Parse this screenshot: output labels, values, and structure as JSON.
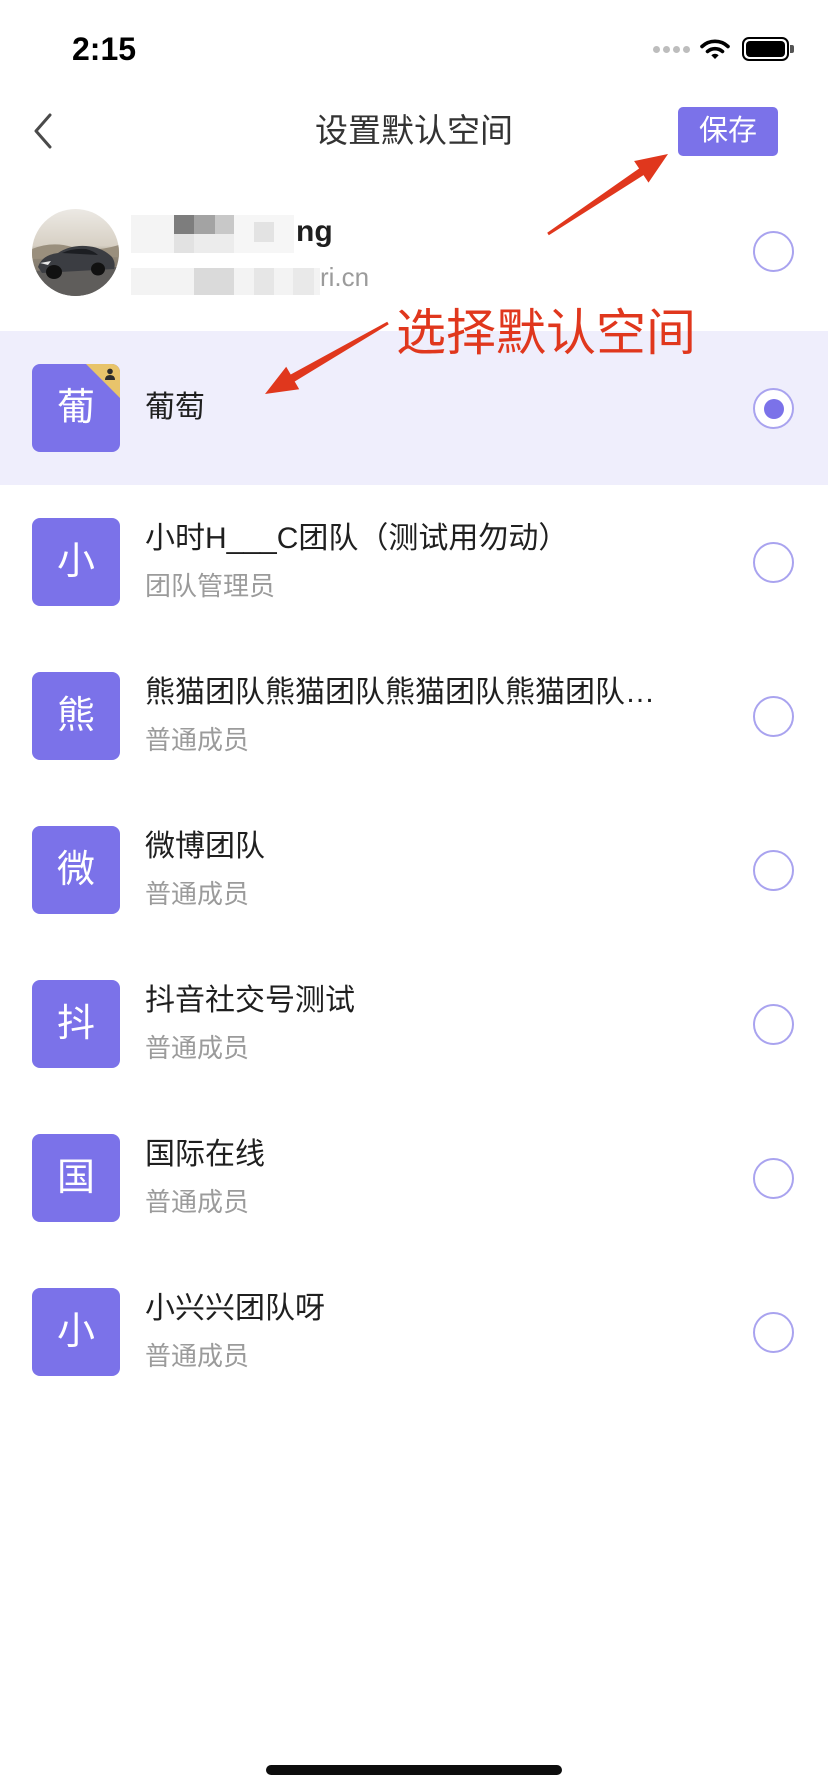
{
  "status_bar": {
    "time": "2:15",
    "icons": [
      "signal-dots-icon",
      "wifi-icon",
      "battery-icon"
    ]
  },
  "nav": {
    "back_icon": "chevron-left-icon",
    "title": "设置默认空间",
    "save_label": "保存"
  },
  "annotation": {
    "text": "选择默认空间"
  },
  "colors": {
    "accent": "#7B72E9",
    "selected_bg": "#EFEEFC",
    "radio_border": "#A9A3EF",
    "annotation": "#E0371D",
    "badge": "#E8C46B"
  },
  "account": {
    "avatar": "car-photo-avatar",
    "name_visible": "ng",
    "email_visible": "ri.cn",
    "selected": false
  },
  "spaces": [
    {
      "icon_char": "葡",
      "name": "葡萄",
      "owner_badge": true,
      "selected": true
    },
    {
      "icon_char": "小",
      "name": "小时H___C团队（测试用勿动）",
      "role": "团队管理员",
      "selected": false
    },
    {
      "icon_char": "熊",
      "name": "熊猫团队熊猫团队熊猫团队熊猫团队…",
      "role": "普通成员",
      "selected": false
    },
    {
      "icon_char": "微",
      "name": "微博团队",
      "role": "普通成员",
      "selected": false
    },
    {
      "icon_char": "抖",
      "name": "抖音社交号测试",
      "role": "普通成员",
      "selected": false
    },
    {
      "icon_char": "国",
      "name": "国际在线",
      "role": "普通成员",
      "selected": false
    },
    {
      "icon_char": "小",
      "name": "小兴兴团队呀",
      "role": "普通成员",
      "selected": false
    }
  ]
}
